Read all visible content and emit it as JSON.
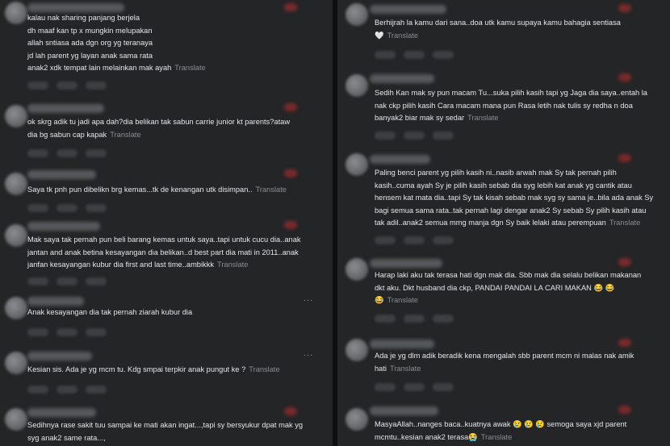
{
  "translate_label": "Translate",
  "more_label": "...",
  "left": [
    {
      "lines": "kalau nak sharing panjang berjela\ndh maaf kan tp x mungkin melupakan\nallah sntiasa ada dgn org yg teranaya\njd lah parent yg layan anak sama rata\nanak2 xdk tempat lain melainkan mak ayah",
      "translate": "Translate"
    },
    {
      "lines": "ok skrg adik tu jadi apa dah?dia belikan tak sabun carrie junior kt parents?ataw\ndia bg sabun cap kapak",
      "translate": "Translate"
    },
    {
      "lines": "Saya tk pnh pun dibelikn brg kemas...tk de kenangan utk disimpan..",
      "translate": "Translate"
    },
    {
      "lines": "Mak saya tak pernah pun beli barang kemas untuk saya..tapi untuk cucu dia..anak\njantan and anak betina kesayangan dia belikan..d best part dia mati in 2011..anak\njanfan kesayangan kubur dia first and last time..ambikkk",
      "translate": "Translate"
    },
    {
      "lines": "Anak kesayangan dia tak pernah ziarah kubur dia",
      "translate": ""
    },
    {
      "lines": "Kesian sis. Ada je yg mcm tu. Kdg smpai terpkir anak pungut ke ?",
      "translate": "Translate"
    },
    {
      "lines": "Sedihnya rase sakit tuu sampai ke mati akan ingat...,tapi sy bersyukur dpat mak yg\nsyg anak2 same rata...,",
      "translate": ""
    }
  ],
  "right": [
    {
      "lines": "Berhijrah la kamu dari sana..doa utk kamu supaya kamu bahagia sentiasa",
      "emoji_line": "🤍",
      "translate": "Translate"
    },
    {
      "lines": "Sedih Kan mak sy pun macam Tu...suka pilih kasih tapi yg Jaga dia saya..entah la\nnak ckp pilih kasih Cara macam mana pun Rasa letih nak tulis sy redha n doa\nbanyak2 biar mak sy sedar",
      "translate": "Translate"
    },
    {
      "lines": "Paling benci parent yg pilih kasih ni..nasib arwah mak Sy tak pernah pilih\nkasih..cuma ayah Sy je pilih kasih sebab dia syg lebih kat anak yg cantik atau\nhensem kat mata dia..tapi Sy tak kisah sebab mak syg sy sama je..bila ada anak Sy\nbagi semua sama rata..tak pernah lagi dengar anak2 Sy sebab Sy pilih kasih atau\ntak adil..anak2 semua mmg manja dgn Sy baik lelaki atau perempuan",
      "translate": "Translate"
    },
    {
      "lines": "Harap laki aku tak terasa hati dgn mak dia. Sbb mak dia selalu belikan makanan\ndkt aku. Dkt husband dia ckp, PANDAI PANDAI LA CARI MAKAN 😂 😂\n😂",
      "translate": "Translate"
    },
    {
      "lines": "Ada je yg dlm adik beradik kena mengalah sbb parent mcm ni malas nak amik\nhati",
      "translate": "Translate"
    },
    {
      "lines": "MasyaAllah..nanges baca..kuatnya awak 😢 😢 😢 semoga saya xjd parent\nmcmtu..kesian anak2 terasa😭",
      "translate": "Translate"
    }
  ]
}
